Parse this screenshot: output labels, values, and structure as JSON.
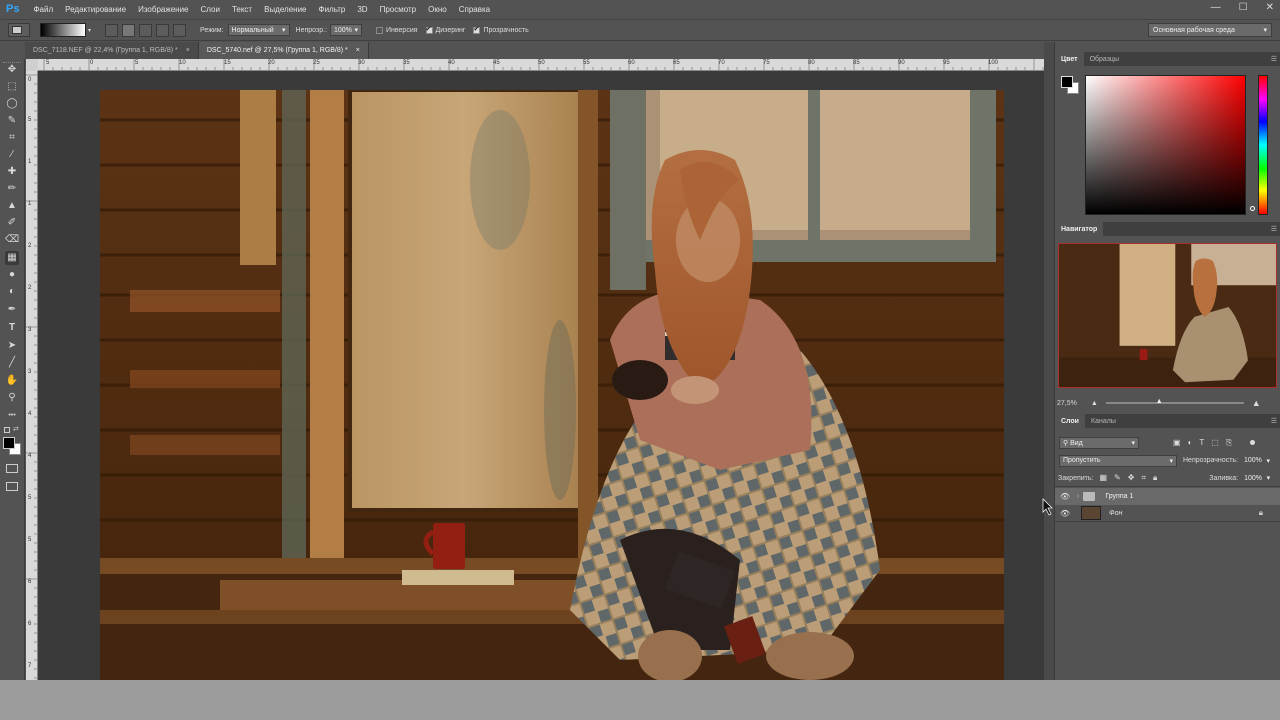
{
  "app": {
    "logo": "Ps",
    "menu": [
      "Файл",
      "Редактирование",
      "Изображение",
      "Слои",
      "Текст",
      "Выделение",
      "Фильтр",
      "3D",
      "Просмотр",
      "Окно",
      "Справка"
    ],
    "window_controls": {
      "minimize": "—",
      "maximize": "☐",
      "close": "✕"
    }
  },
  "options_bar": {
    "mode_label": "Режим:",
    "mode_value": "Нормальный",
    "opacity_label": "Непрозр.:",
    "opacity_value": "100%",
    "inversion_label": "Инверсия",
    "inversion_checked": false,
    "dither_label": "Дизеринг",
    "dither_checked": true,
    "transparency_label": "Прозрачность",
    "transparency_checked": true,
    "workspace": "Основная рабочая среда"
  },
  "tabs": [
    {
      "label": "DSC_7118.NEF @ 22,4% (Группа 1, RGB/8) *",
      "close": "×",
      "active": false
    },
    {
      "label": "DSC_5740.nef @ 27,5% (Группа 1, RGB/8) *",
      "close": "×",
      "active": true
    }
  ],
  "toolbox": {
    "icons": [
      "move-icon",
      "marquee-icon",
      "lasso-icon",
      "quick-select-icon",
      "crop-icon",
      "eyedropper-icon",
      "healing-icon",
      "brush-icon",
      "stamp-icon",
      "history-brush-icon",
      "eraser-icon",
      "gradient-icon",
      "blur-icon",
      "dodge-icon",
      "pen-icon",
      "type-icon",
      "path-select-icon",
      "line-icon",
      "hand-icon",
      "zoom-icon",
      "more-icon"
    ],
    "glyphs": [
      "✥",
      "⬚",
      "◯",
      "✎",
      "⌗",
      "⁄",
      "✚",
      "✏",
      "▲",
      "✐",
      "⌫",
      "▦",
      "●",
      "◐",
      "✒",
      "T",
      "➤",
      "╱",
      "✋",
      "⚲",
      "•••"
    ]
  },
  "ruler": {
    "h_labels": [
      "5",
      "0",
      "5",
      "10",
      "15",
      "20",
      "25",
      "30",
      "35",
      "40",
      "45",
      "50",
      "55",
      "60",
      "65",
      "70",
      "75",
      "80",
      "85",
      "90",
      "95",
      "100"
    ],
    "v_labels": [
      "0",
      "5",
      "1",
      "1",
      "2",
      "2",
      "3",
      "3",
      "4",
      "4",
      "5",
      "5",
      "6",
      "6",
      "7"
    ]
  },
  "color_panel": {
    "tabs": [
      "Цвет",
      "Образцы"
    ],
    "foreground": "#000000",
    "background": "#ffffff",
    "hue": "#ff0000"
  },
  "navigator": {
    "title": "Навигатор",
    "zoom": "27,5%"
  },
  "layers_panel": {
    "tabs": [
      "Слои",
      "Каналы"
    ],
    "filter_label": "Вид",
    "blend_mode": "Пропустить",
    "opacity_label": "Непрозрачность:",
    "opacity_value": "100%",
    "lock_label": "Закрепить:",
    "fill_label": "Заливка:",
    "fill_value": "100%",
    "layers": [
      {
        "name": "Группа 1",
        "type": "group",
        "visible": true,
        "selected": true
      },
      {
        "name": "Фон",
        "type": "image",
        "visible": true,
        "locked": true
      }
    ]
  },
  "colors": {
    "ui_bg": "#535353",
    "ui_dark": "#3f3f3f",
    "ps_blue": "#31a8ff",
    "navigator_frame": "#aa3030"
  }
}
